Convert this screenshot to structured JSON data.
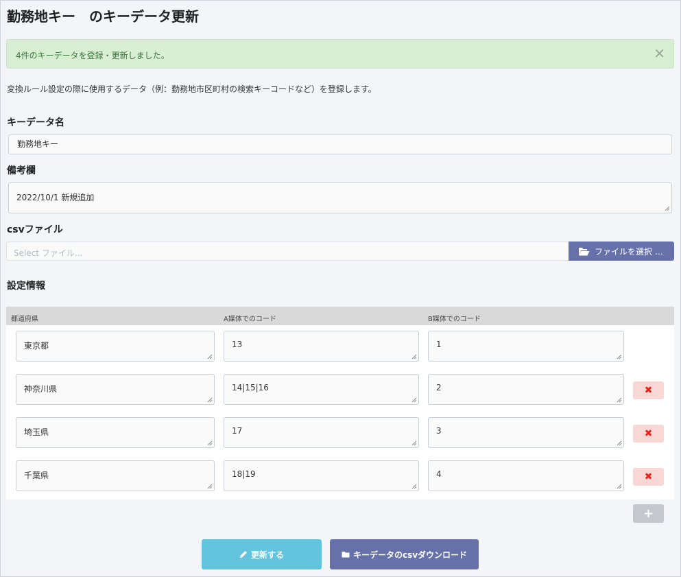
{
  "page": {
    "title": "勤務地キー　のキーデータ更新"
  },
  "alert": {
    "message": "4件のキーデータを登録・更新しました。",
    "close_glyph": "✕"
  },
  "description": "変換ルール設定の際に使用するデータ（例：勤務地市区町村の検索キーコードなど）を登録します。",
  "form": {
    "key_name_label": "キーデータ名",
    "key_name_value": "勤務地キー",
    "remarks_label": "備考欄",
    "remarks_value": "2022/10/1 新規追加",
    "csv_label": "csvファイル",
    "csv_placeholder": "Select ファイル...",
    "csv_button_label": "ファイルを選択 …"
  },
  "settings": {
    "label": "設定情報",
    "columns": [
      "都道府県",
      "A媒体でのコード",
      "B媒体でのコード"
    ],
    "rows": [
      {
        "prefecture": "東京都",
        "code_a": "13",
        "code_b": "1",
        "deletable": false
      },
      {
        "prefecture": "神奈川県",
        "code_a": "14|15|16",
        "code_b": "2",
        "deletable": true
      },
      {
        "prefecture": "埼玉県",
        "code_a": "17",
        "code_b": "3",
        "deletable": true
      },
      {
        "prefecture": "千葉県",
        "code_a": "18|19",
        "code_b": "4",
        "deletable": true
      }
    ],
    "delete_glyph": "✖",
    "add_glyph": "+"
  },
  "actions": {
    "update_label": "更新する",
    "download_label": "キーデータのcsvダウンロード"
  },
  "colors": {
    "alert_bg": "#d9efd4",
    "alert_text": "#3c763d",
    "primary_purple": "#6670a9",
    "info_cyan": "#62c4dd",
    "danger_bg": "#f9d7d5",
    "danger_icon": "#e8221b",
    "table_header": "#d9d9d9"
  },
  "icons": {
    "alert_close": "close-icon",
    "file_button": "folder-open-icon",
    "delete": "times-icon",
    "add": "plus-icon",
    "update": "pencil-icon",
    "download": "folder-icon"
  }
}
